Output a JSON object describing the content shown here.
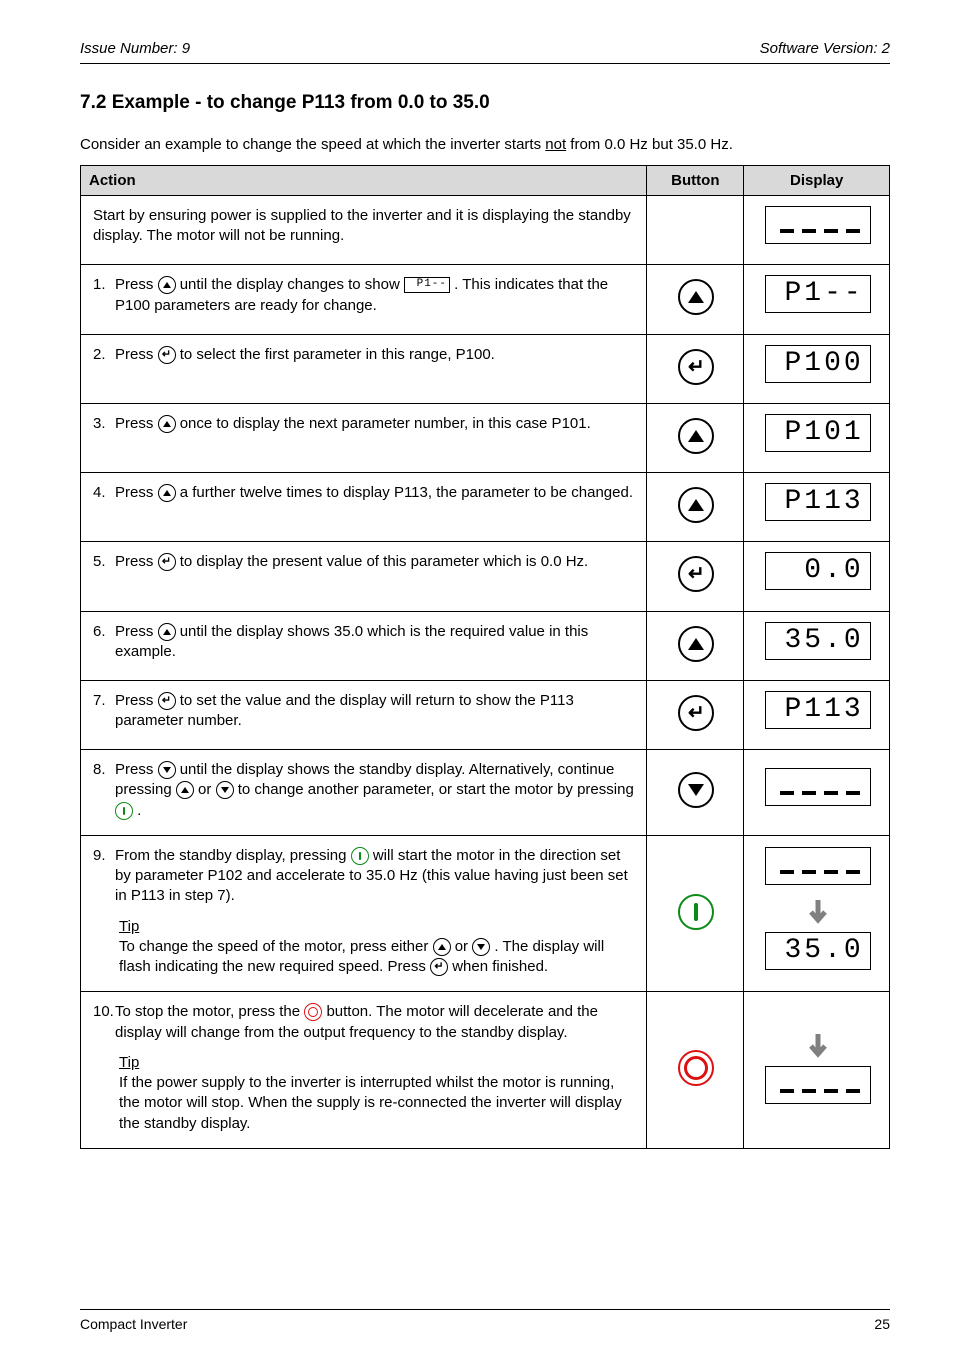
{
  "header": {
    "left": "Issue Number: 9",
    "right": "Software Version: 2"
  },
  "title": "7.2 Example - to change P113 from 0.0 to 35.0",
  "intro_pre": "Consider an example to change the speed at which the inverter starts ",
  "intro_u": "not",
  "intro_post": " from 0.0 Hz but 35.0 Hz.",
  "columns": {
    "h1": "Action",
    "h2": "Button",
    "h3": "Display"
  },
  "rows": [
    {
      "text": [
        {
          "frag": "Start by ensuring power is supplied to the inverter and it is displaying the standby display. The motor will not be running."
        }
      ],
      "lcd": "dashes"
    },
    {
      "steps": [
        {
          "n": "1.",
          "t_pre": "Press ",
          "icon": "up",
          "t_mid": " until the display changes to show ",
          "mini_lcd": "P1--",
          "t_post": ". This indicates that the P100 parameters are ready for change."
        }
      ],
      "btn": "up",
      "lcd": "P1--"
    },
    {
      "steps": [
        {
          "n": "2.",
          "t_pre": "Press ",
          "icon": "enter",
          "t_post": " to select the first parameter in this range, P100."
        }
      ],
      "btn": "enter",
      "lcd": "P100"
    },
    {
      "steps": [
        {
          "n": "3.",
          "t_pre": "Press ",
          "icon": "up",
          "t_post": " once to display the next parameter number, in this case P101."
        }
      ],
      "btn": "up",
      "lcd": "P101"
    },
    {
      "steps": [
        {
          "n": "4.",
          "t_pre": "Press ",
          "icon": "up",
          "t_post": " a further twelve times to display P113, the parameter to be changed."
        }
      ],
      "btn": "up",
      "lcd": "P113"
    },
    {
      "steps": [
        {
          "n": "5.",
          "t_pre": "Press ",
          "icon": "enter",
          "t_post": " to display the present value of this parameter which is 0.0 Hz."
        }
      ],
      "btn": "enter",
      "lcd": "0.0"
    },
    {
      "steps": [
        {
          "n": "6.",
          "t_pre": "Press ",
          "icon": "up",
          "t_post": " until the display shows 35.0 which is the required value in this example."
        }
      ],
      "btn": "up",
      "lcd": "35.0"
    },
    {
      "steps": [
        {
          "n": "7.",
          "t_pre": "Press ",
          "icon": "enter",
          "t_post": " to set the value and the display will return to show the P113 parameter number."
        }
      ],
      "btn": "enter",
      "lcd": "P113"
    },
    {
      "steps": [
        {
          "n": "8.",
          "t_pre": "Press ",
          "icon": "down",
          "t_post": " until the display shows the standby display. Alternatively, continue pressing ",
          "icon2": "up",
          "t_mid2": " or ",
          "icon3": "down",
          "t_after2": " to change another parameter, or start the motor by pressing ",
          "icon4": "power",
          "t_end": "."
        }
      ],
      "btn": "down",
      "lcd": "dashes"
    },
    {
      "multi9": {
        "n": "9.",
        "line1_pre": "From the standby display, pressing ",
        "line1_post": " will start the motor in the direction set by parameter P102 and accelerate to 35.0 Hz (this value having just been set in P113 in step 7).",
        "tip_label": "Tip",
        "tip_pre": "To change the speed of the motor, press either ",
        "tip_or": " or ",
        "tip_mid": ". The display will flash indicating the new required speed. Press ",
        "tip_post": " when finished."
      },
      "btn": "power-big",
      "lcd_pair": {
        "first": "dashes",
        "second": "35.0"
      }
    },
    {
      "multi10": {
        "n": "10.",
        "line1_pre": "To stop the motor, press the ",
        "line1_post": " button. The motor will decelerate and the display will change from the output frequency to the standby display.",
        "tip_label": "Tip",
        "tip_body": "If the power supply to the inverter is interrupted whilst the motor is running, the motor will stop. When the supply is re-connected the inverter will display the standby display."
      },
      "btn": "stop-big",
      "lcd_arrow_to": "dashes"
    }
  ],
  "footer": {
    "left": "Compact Inverter",
    "right": "25"
  }
}
